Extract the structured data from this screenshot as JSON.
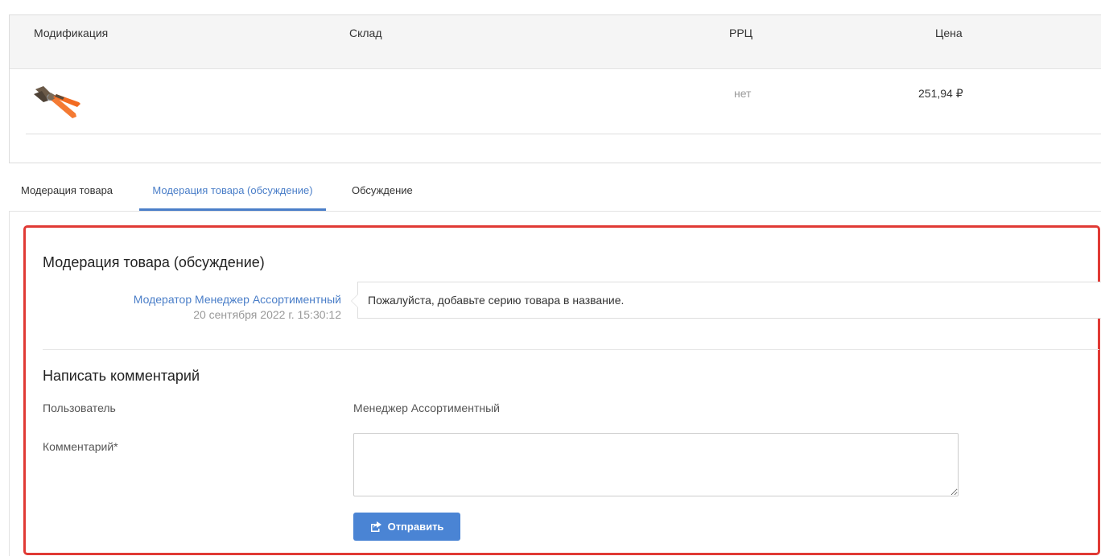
{
  "table": {
    "headers": {
      "modification": "Модификация",
      "warehouse": "Склад",
      "rrc": "РРЦ",
      "price": "Цена"
    },
    "row": {
      "thumbnail_icon": "crimping-pliers-icon",
      "rrc": "нет",
      "price": "251,94 ₽"
    }
  },
  "tabs": [
    {
      "label": "Модерация товара",
      "active": false
    },
    {
      "label": "Модерация товара (обсуждение)",
      "active": true
    },
    {
      "label": "Обсуждение",
      "active": false
    }
  ],
  "discussion": {
    "title": "Модерация товара (обсуждение)",
    "messages": [
      {
        "author": "Модератор Менеджер Ассортиментный",
        "date": "20 сентября 2022 г. 15:30:12",
        "text": "Пожалуйста, добавьте серию товара в название."
      }
    ]
  },
  "comment_form": {
    "title": "Написать комментарий",
    "user_label": "Пользователь",
    "user_value": "Менеджер Ассортиментный",
    "comment_label": "Комментарий*",
    "comment_value": "",
    "submit_label": "Отправить",
    "submit_icon": "share-icon"
  },
  "colors": {
    "accent": "#4a7ec8",
    "button": "#4a84d4",
    "highlight_border": "#e03a35",
    "muted_text": "#999999"
  }
}
